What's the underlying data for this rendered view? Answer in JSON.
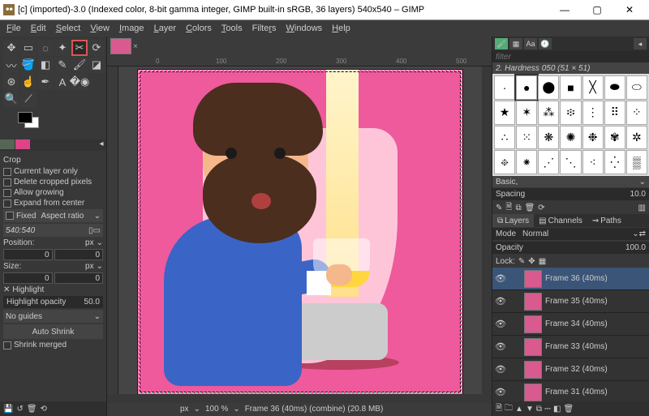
{
  "window": {
    "title": "[c] (imported)-3.0 (Indexed color, 8-bit gamma integer, GIMP built-in sRGB, 36 layers) 540x540 – GIMP",
    "min": "—",
    "max": "▢",
    "close": "✕"
  },
  "menu": [
    "File",
    "Edit",
    "Select",
    "View",
    "Image",
    "Layer",
    "Colors",
    "Tools",
    "Filters",
    "Windows",
    "Help"
  ],
  "ruler_ticks": [
    "0",
    "100",
    "200",
    "300",
    "400",
    "500"
  ],
  "toolopts": {
    "header": "Crop",
    "o1": "Current layer only",
    "o2": "Delete cropped pixels",
    "o3": "Allow growing",
    "o4": "Expand from center",
    "fixed": "Fixed",
    "fixed_mode": "Aspect ratio",
    "ratio": "540:540",
    "position_lbl": "Position:",
    "position_unit": "px",
    "pos_x": "0",
    "pos_y": "0",
    "size_lbl": "Size:",
    "size_unit": "px",
    "size_w": "0",
    "size_h": "0",
    "highlight": "Highlight",
    "hl_opacity_lbl": "Highlight opacity",
    "hl_opacity_val": "50.0",
    "guides": "No guides",
    "auto_shrink": "Auto Shrink",
    "shrink_merged": "Shrink merged"
  },
  "status": {
    "unit": "px",
    "zoom": "100 %",
    "frame": "Frame 36 (40ms) (combine) (20.8 MB)"
  },
  "brushes": {
    "filter": "filter",
    "selected": "2. Hardness 050 (51 × 51)",
    "preset": "Basic,",
    "spacing_lbl": "Spacing",
    "spacing_val": "10.0"
  },
  "layers": {
    "tab_layers": "Layers",
    "tab_channels": "Channels",
    "tab_paths": "Paths",
    "mode_lbl": "Mode",
    "mode_val": "Normal",
    "opacity_lbl": "Opacity",
    "opacity_val": "100.0",
    "lock_lbl": "Lock:",
    "items": [
      {
        "name": "Frame 36 (40ms)",
        "active": true
      },
      {
        "name": "Frame 35 (40ms)"
      },
      {
        "name": "Frame 34 (40ms)"
      },
      {
        "name": "Frame 33 (40ms)"
      },
      {
        "name": "Frame 32 (40ms)"
      },
      {
        "name": "Frame 31 (40ms)"
      }
    ]
  }
}
